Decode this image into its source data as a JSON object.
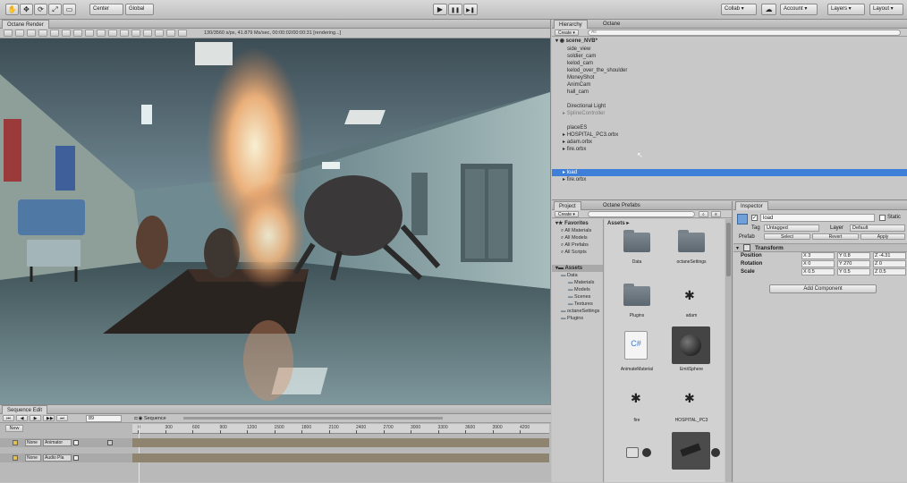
{
  "toolbar": {
    "tools": [
      "✋",
      "✥",
      "⟳",
      "⤢",
      "▭"
    ],
    "pivot_label": "Center",
    "space_label": "Global",
    "play": "▶",
    "pause": "❚❚",
    "step": "▶❚",
    "collab_label": "Collab ▾",
    "cloud": "☁",
    "account_label": "Account ▾",
    "layers_label": "Layers ▾",
    "layout_label": "Layout ▾"
  },
  "render": {
    "tab": "Octane Render",
    "status": "130/3560 s/px, 41.879 Ms/sec, 00:00:02/00:00:31 [rendering...]"
  },
  "hierarchy": {
    "tabs": [
      "Hierarchy",
      "Octane"
    ],
    "create_label": "Create ▾",
    "search_placeholder": "All",
    "scene_name": "scene_NVB*",
    "items": [
      "side_view",
      "soldier_cam",
      "kelod_cam",
      "kelod_over_the_shoulder",
      "MoneyShot",
      "AnimCam",
      "hall_cam",
      "",
      "Directional Light",
      "SplineController",
      "",
      "placeES",
      "HOSPITAL_PC3.orbx",
      "adam.orbx",
      "fire.orbx"
    ],
    "selected_item": "load",
    "after_selected": "fire.orbx"
  },
  "project": {
    "tabs": [
      "Project",
      "Octane Prefabs"
    ],
    "create_label": "Create ▾",
    "favorites_label": "Favorites",
    "favorites": [
      "All Materials",
      "All Models",
      "All Prefabs",
      "All Scripts"
    ],
    "assets_label": "Assets",
    "tree": [
      "Data",
      "Materials",
      "Models",
      "Scenes",
      "Textures",
      "octaneSettings",
      "Plugins"
    ],
    "breadcrumb": "Assets ▸",
    "grid_items": [
      {
        "label": "Data"
      },
      {
        "label": "octaneSettings"
      },
      {
        "label": "Plugins"
      },
      {
        "label": "adam"
      },
      {
        "label": "AnimateMaterial"
      },
      {
        "label": "EmitSphere"
      },
      {
        "label": "fire"
      },
      {
        "label": "HOSPITAL_PC3"
      }
    ]
  },
  "inspector": {
    "tab": "Inspector",
    "object_name": "load",
    "static_label": "Static",
    "tag_label": "Tag",
    "tag_value": "Untagged",
    "layer_label": "Layer",
    "layer_value": "Default",
    "prefab_label": "Prefab",
    "prefab_buttons": [
      "Select",
      "Revert",
      "Apply"
    ],
    "transform_label": "Transform",
    "position_label": "Position",
    "rotation_label": "Rotation",
    "scale_label": "Scale",
    "position": {
      "x": "X 3",
      "y": "Y 0.8",
      "z": "Z -4.31"
    },
    "rotation": {
      "x": "X 0",
      "y": "Y 270",
      "z": "Z 0"
    },
    "scale": {
      "x": "X 0.5",
      "y": "Y 0.5",
      "z": "Z 0.5"
    },
    "add_component": "Add Component"
  },
  "sequence": {
    "tab": "Sequence Edit",
    "frame": "89",
    "new_label": "New",
    "sequence_label": "Sequence",
    "ruler": [
      "0",
      "300",
      "600",
      "900",
      "1200",
      "1500",
      "1800",
      "2100",
      "2400",
      "2700",
      "3000",
      "3300",
      "3600",
      "3900",
      "4200"
    ],
    "tracks": [
      {
        "none": "None",
        "name": "Animator"
      },
      {
        "none": "None",
        "name": "Audio Pla"
      }
    ]
  },
  "colors": {
    "selection": "#3e7fd9",
    "panel": "#c2c2c2",
    "timeline_track": "#8f8470"
  }
}
